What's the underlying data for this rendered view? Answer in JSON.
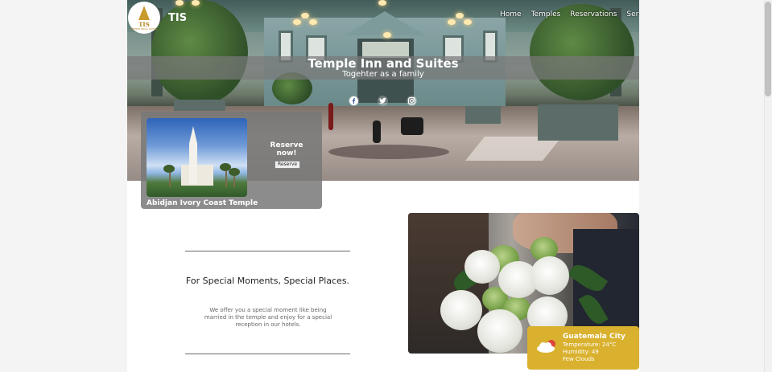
{
  "brand": {
    "logo_text": "TIS",
    "logo_subtext": "TEMPLE INN & SUITES",
    "name": "TIS"
  },
  "nav": [
    {
      "label": "Home"
    },
    {
      "label": "Temples"
    },
    {
      "label": "Reservations"
    },
    {
      "label": "Services"
    }
  ],
  "hero": {
    "title": "Temple Inn and Suites",
    "subtitle": "Togehter as a family"
  },
  "social": [
    {
      "icon": "facebook-icon"
    },
    {
      "icon": "twitter-icon"
    },
    {
      "icon": "instagram-icon"
    }
  ],
  "reserve_card": {
    "heading": "Reserve now!",
    "button_label": "Reserve",
    "temple_name": "Abidjan Ivory Coast Temple"
  },
  "moments": {
    "title": "For Special Moments, Special Places.",
    "body": "We offer you a special moment like being married in the temple and enjoy for a special reception in our hotels."
  },
  "weather": {
    "city": "Guatemala City",
    "temperature": "Temperature: 24°C",
    "humidity": "Humidity: 49",
    "condition": "Few Clouds",
    "icon": "few-clouds-icon"
  },
  "colors": {
    "accent": "#d9b12e",
    "overlay": "#787878",
    "background": "#f4f4f4"
  }
}
